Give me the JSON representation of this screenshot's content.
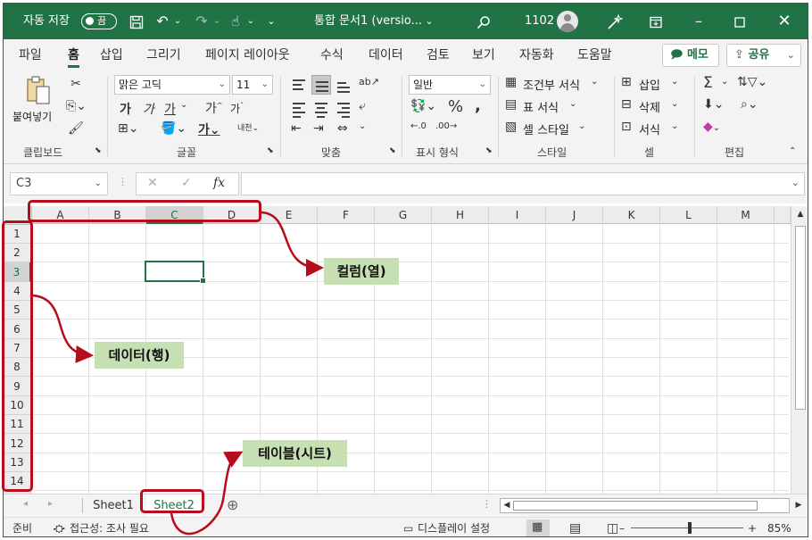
{
  "titlebar": {
    "autosave_label": "자동 저장",
    "autosave_state": "끔",
    "doc_title": "통합 문서1 (versio...",
    "search_hint": "1102",
    "accent": "#217346"
  },
  "tabs": [
    "파일",
    "홈",
    "삽입",
    "그리기",
    "페이지 레이아웃",
    "수식",
    "데이터",
    "검토",
    "보기",
    "자동화",
    "도움말"
  ],
  "active_tab": "홈",
  "memo_button": "메모",
  "share_button": "공유",
  "ribbon": {
    "clipboard": {
      "paste": "붙여넣기",
      "label": "클립보드"
    },
    "font": {
      "font_name": "맑은 고딕",
      "font_size": "11",
      "label": "글꼴"
    },
    "align": {
      "label": "맞춤"
    },
    "number": {
      "format": "일반",
      "label": "표시 형식"
    },
    "styles": {
      "conditional": "조건부 서식",
      "table": "표 서식",
      "cell": "셀 스타일",
      "label": "스타일"
    },
    "cells": {
      "insert": "삽입",
      "delete": "삭제",
      "format": "서식",
      "label": "셀"
    },
    "editing": {
      "label": "편집"
    }
  },
  "formula_bar": {
    "name_box": "C3",
    "value": ""
  },
  "grid": {
    "columns": [
      "A",
      "B",
      "C",
      "D",
      "E",
      "F",
      "G",
      "H",
      "I",
      "J",
      "K",
      "L",
      "M"
    ],
    "rows": [
      "1",
      "2",
      "3",
      "4",
      "5",
      "6",
      "7",
      "8",
      "9",
      "10",
      "11",
      "12",
      "13",
      "14"
    ],
    "selected_cell": "C3"
  },
  "sheets": [
    "Sheet1",
    "Sheet2"
  ],
  "active_sheet": "Sheet2",
  "statusbar": {
    "ready": "준비",
    "accessibility": "접근성: 조사 필요",
    "display_settings": "디스플레이 설정",
    "zoom": "85%",
    "zoom_fraction": 0.5
  },
  "annotations": {
    "columns": "컬럼(열)",
    "rows": "데이터(행)",
    "table": "테이블(시트)",
    "color": "#b80c1c"
  }
}
